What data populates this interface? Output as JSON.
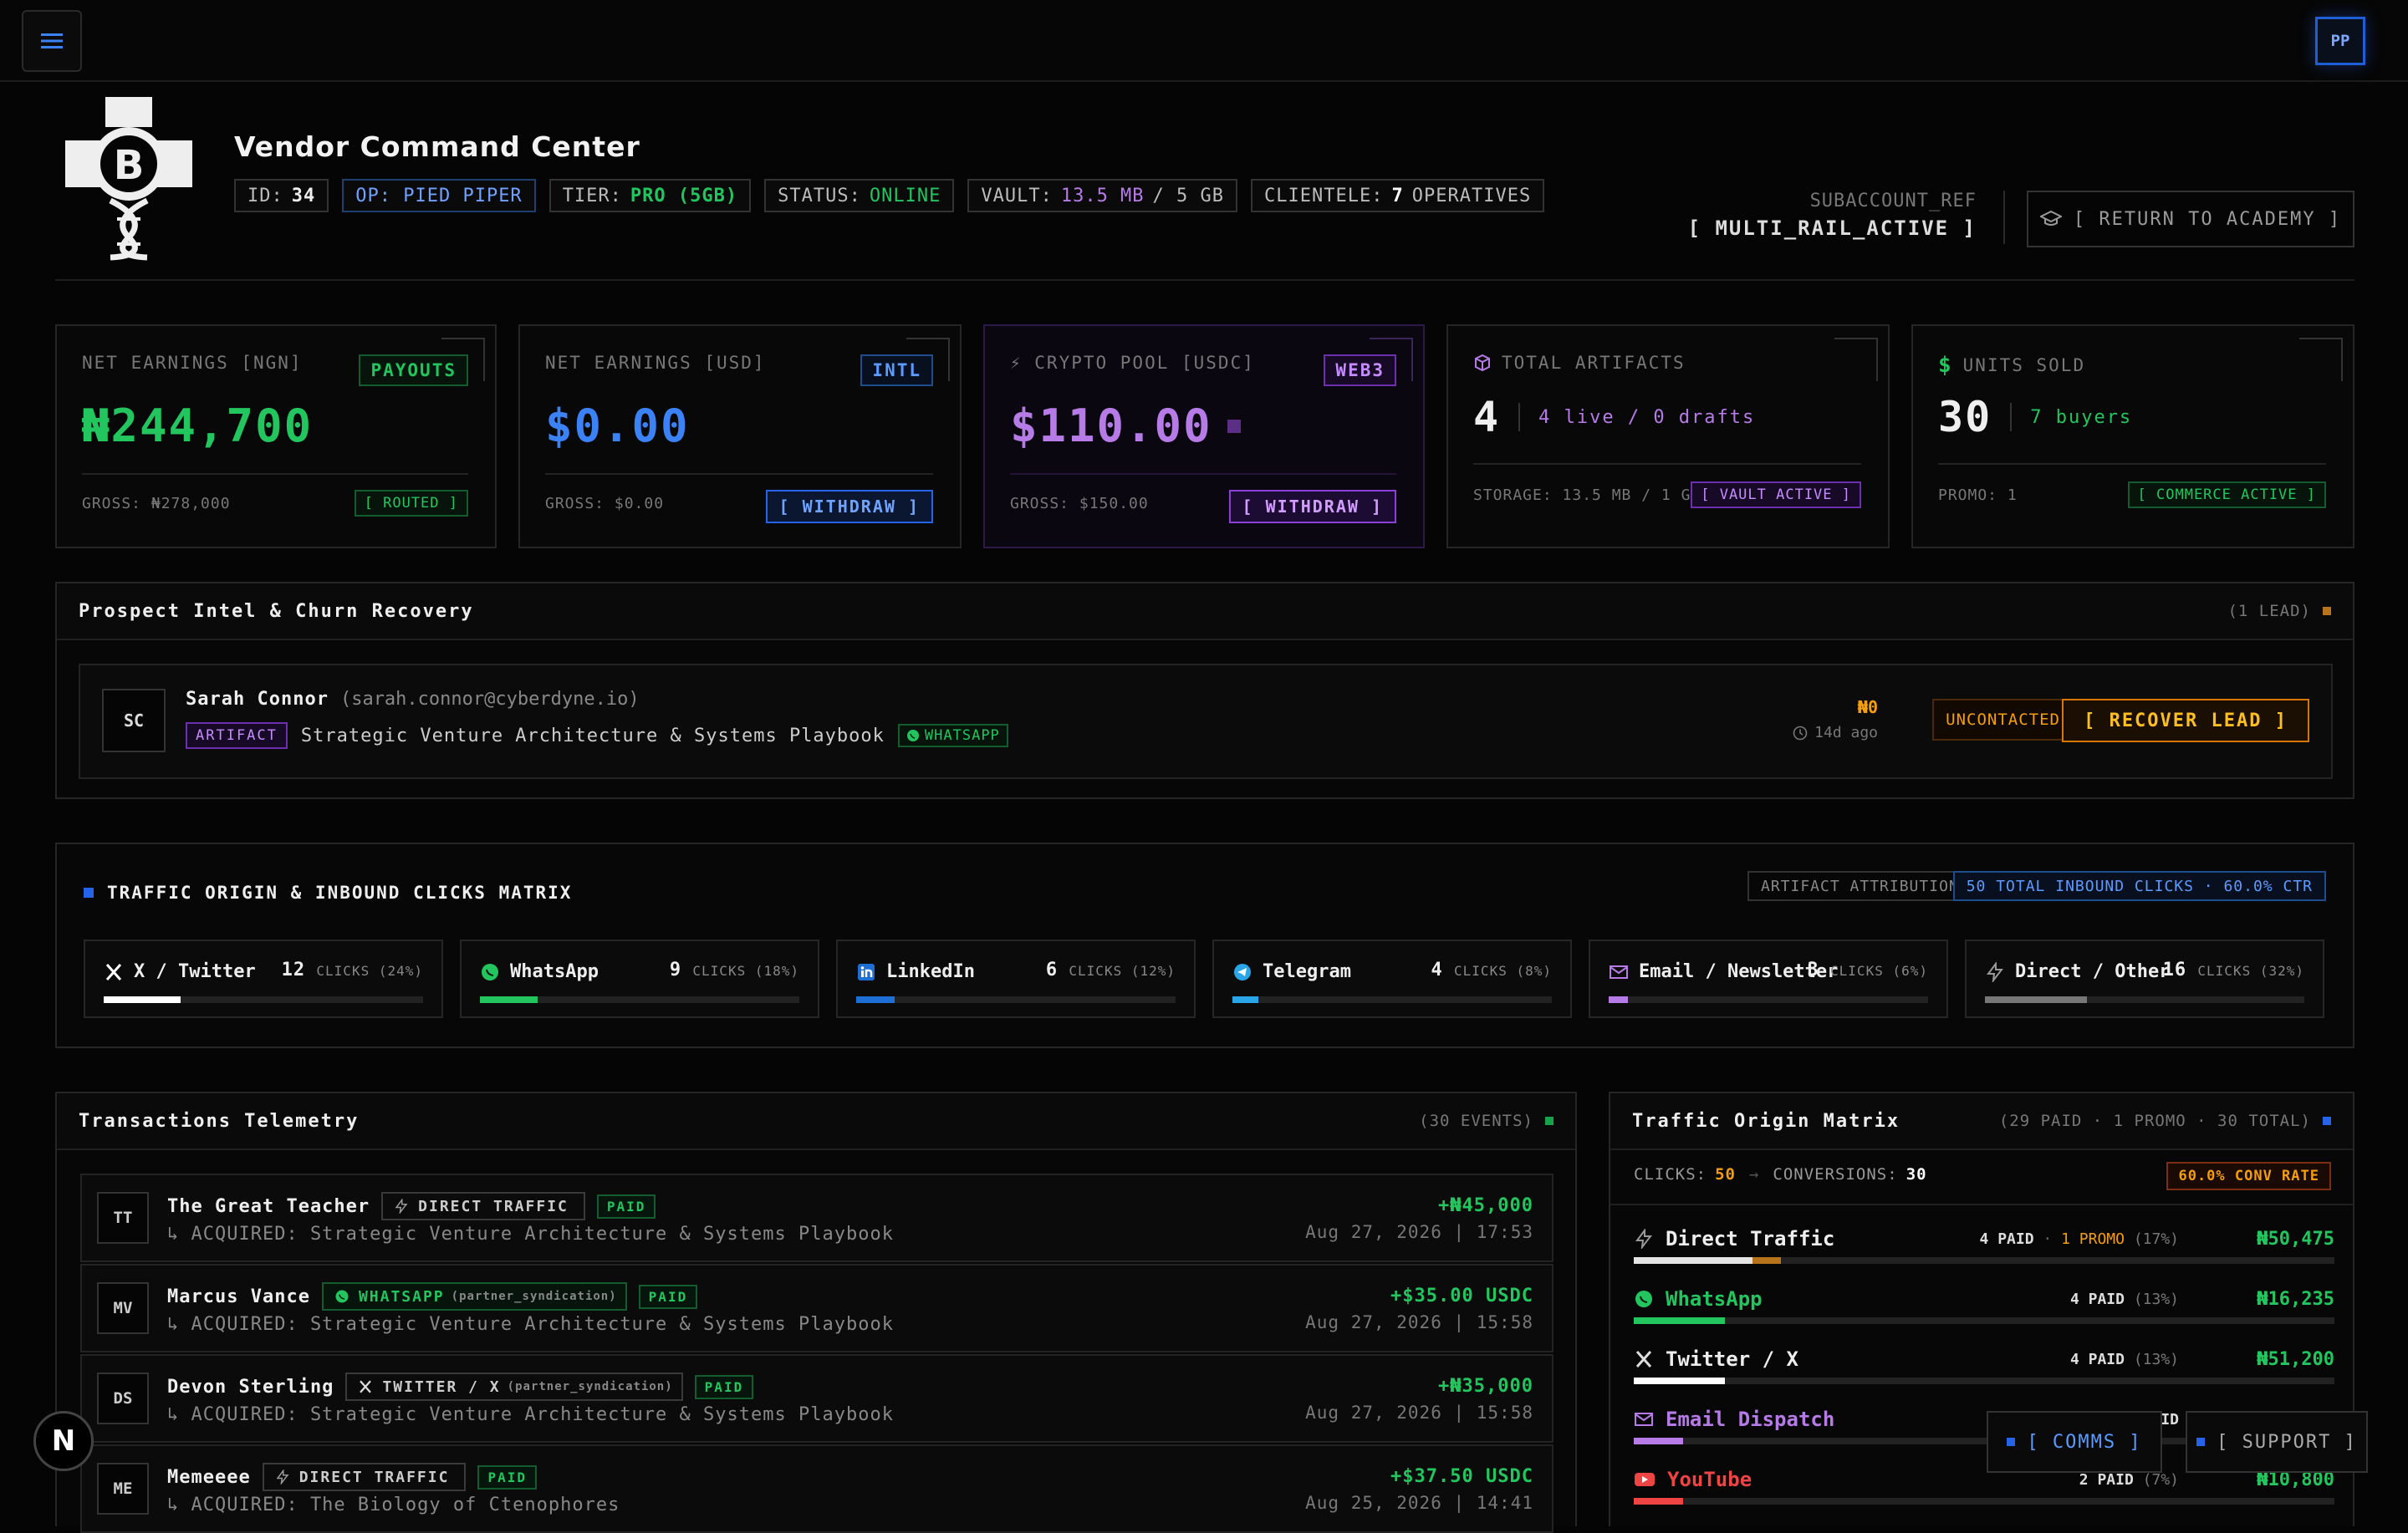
{
  "topbar": {
    "avatar_initials": "PP"
  },
  "header": {
    "title": "Vendor Command Center",
    "chips": {
      "id_label": "ID:",
      "id_value": "34",
      "op": "OP: PIED PIPER",
      "tier_label": "TIER:",
      "tier_value": "PRO (5GB)",
      "status_label": "STATUS:",
      "status_value": "ONLINE",
      "vault_label": "VAULT:",
      "vault_value": "13.5 MB",
      "vault_total": "/ 5 GB",
      "clientele_label": "CLIENTELE:",
      "clientele_value": "7",
      "clientele_suffix": "OPERATIVES"
    },
    "subaccount_label": "SUBACCOUNT_REF",
    "subaccount_value": "[ MULTI_RAIL_ACTIVE ]",
    "academy_button": "[ RETURN TO ACADEMY ]"
  },
  "cards": {
    "ngn": {
      "label": "NET EARNINGS [NGN]",
      "tag": "PAYOUTS",
      "value": "₦244,700",
      "gross": "GROSS: ₦278,000",
      "badge": "[ ROUTED ]"
    },
    "usd": {
      "label": "NET EARNINGS [USD]",
      "tag": "INTL",
      "value": "$0.00",
      "gross": "GROSS: $0.00",
      "button": "[ WITHDRAW ]"
    },
    "crypto": {
      "label": "⚡ CRYPTO POOL [USDC]",
      "tag": "WEB3",
      "value": "$110.00",
      "gross": "GROSS: $150.00",
      "button": "[ WITHDRAW ]"
    },
    "artifacts": {
      "label": "TOTAL ARTIFACTS",
      "value": "4",
      "detail": "4 live / 0 drafts",
      "storage": "STORAGE: 13.5 MB / 1 GB",
      "badge": "[ VAULT ACTIVE ]"
    },
    "units": {
      "label": "UNITS SOLD",
      "value": "30",
      "detail": "7 buyers",
      "promo": "PROMO: 1",
      "badge": "[ COMMERCE ACTIVE ]"
    }
  },
  "prospect": {
    "title": "Prospect Intel & Churn Recovery",
    "count": "(1 LEAD)",
    "lead": {
      "initials": "SC",
      "name": "Sarah Connor",
      "email": "(sarah.connor@cyberdyne.io)",
      "type_badge": "ARTIFACT",
      "product": "Strategic Venture Architecture & Systems Playbook",
      "channel": "WHATSAPP",
      "amount": "₦0",
      "age": "14d ago",
      "status": "UNCONTACTED",
      "action": "[ RECOVER LEAD ]"
    }
  },
  "traffic": {
    "title": "TRAFFIC ORIGIN & INBOUND CLICKS MATRIX",
    "attribution": "ARTIFACT ATTRIBUTION",
    "summary": "50 TOTAL INBOUND CLICKS · 60.0% CTR",
    "sources": [
      {
        "name": "X / Twitter",
        "count": "12",
        "pct": "CLICKS (24%)",
        "share": 0.24,
        "color": "#ffffff",
        "icon": "x-icon"
      },
      {
        "name": "WhatsApp",
        "count": "9",
        "pct": "CLICKS (18%)",
        "share": 0.18,
        "color": "#22c55e",
        "icon": "whatsapp-icon"
      },
      {
        "name": "LinkedIn",
        "count": "6",
        "pct": "CLICKS (12%)",
        "share": 0.12,
        "color": "#1d6fd6",
        "icon": "linkedin-icon"
      },
      {
        "name": "Telegram",
        "count": "4",
        "pct": "CLICKS (8%)",
        "share": 0.08,
        "color": "#2aa5e8",
        "icon": "telegram-icon"
      },
      {
        "name": "Email / Newsletter",
        "count": "3",
        "pct": "CLICKS (6%)",
        "share": 0.06,
        "color": "#b77be8",
        "icon": "mail-icon"
      },
      {
        "name": "Direct / Other",
        "count": "16",
        "pct": "CLICKS (32%)",
        "share": 0.32,
        "color": "#777777",
        "icon": "bolt-icon"
      }
    ]
  },
  "transactions": {
    "title": "Transactions Telemetry",
    "count": "(30 EVENTS)",
    "rows": [
      {
        "initials": "TT",
        "name": "The Great Teacher",
        "source": "DIRECT TRAFFIC",
        "source_sub": "",
        "status": "PAID",
        "acquired": "↳ ACQUIRED: Strategic Venture Architecture & Systems Playbook",
        "amount": "+₦45,000",
        "date": "Aug 27, 2026 | 17:53"
      },
      {
        "initials": "MV",
        "name": "Marcus Vance",
        "source": "WHATSAPP",
        "source_sub": "(partner_syndication)",
        "status": "PAID",
        "acquired": "↳ ACQUIRED: Strategic Venture Architecture & Systems Playbook",
        "amount": "+$35.00 USDC",
        "date": "Aug 27, 2026 | 15:58"
      },
      {
        "initials": "DS",
        "name": "Devon Sterling",
        "source": "TWITTER / X",
        "source_sub": "(partner_syndication)",
        "status": "PAID",
        "acquired": "↳ ACQUIRED: Strategic Venture Architecture & Systems Playbook",
        "amount": "+₦35,000",
        "date": "Aug 27, 2026 | 15:58"
      },
      {
        "initials": "ME",
        "name": "Memeeee",
        "source": "DIRECT TRAFFIC",
        "source_sub": "",
        "status": "PAID",
        "acquired": "↳ ACQUIRED: The Biology of Ctenophores",
        "amount": "+$37.50 USDC",
        "date": "Aug 25, 2026 | 14:41"
      }
    ]
  },
  "origin": {
    "title": "Traffic Origin Matrix",
    "summary": "(29 PAID · 1 PROMO · 30 TOTAL)",
    "clicks_label": "CLICKS:",
    "clicks_value": "50",
    "conv_label": "CONVERSIONS:",
    "conv_value": "30",
    "rate": "60.0% CONV RATE",
    "rows": [
      {
        "name": "Direct Traffic",
        "paid": "4 PAID",
        "promo": "1 PROMO",
        "pct": "(17%)",
        "revenue": "₦50,475",
        "share": 0.17,
        "color": "#e5e5e5",
        "icon": "bolt-icon"
      },
      {
        "name": "WhatsApp",
        "paid": "4 PAID",
        "promo": "",
        "pct": "(13%)",
        "revenue": "₦16,235",
        "share": 0.13,
        "color": "#22c55e",
        "icon": "whatsapp-icon"
      },
      {
        "name": "Twitter / X",
        "paid": "4 PAID",
        "promo": "",
        "pct": "(13%)",
        "revenue": "₦51,200",
        "share": 0.13,
        "color": "#ffffff",
        "icon": "x-icon"
      },
      {
        "name": "Email Dispatch",
        "paid": "AID",
        "promo": "",
        "pct": "",
        "revenue": "",
        "share": 0.07,
        "color": "#b77be8",
        "icon": "mail-icon"
      },
      {
        "name": "YouTube",
        "paid": "2 PAID",
        "promo": "",
        "pct": "(7%)",
        "revenue": "₦10,800",
        "share": 0.07,
        "color": "#ef4444",
        "icon": "youtube-icon"
      }
    ]
  },
  "floating": {
    "comms": "[ COMMS ]",
    "support": "[ SUPPORT ]",
    "next_badge": "N"
  }
}
